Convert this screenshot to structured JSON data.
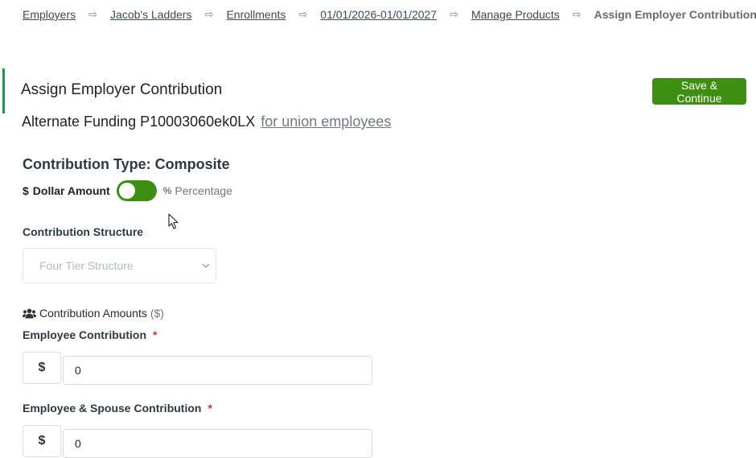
{
  "breadcrumb": {
    "items": [
      "Employers",
      "Jacob's Ladders",
      "Enrollments",
      "01/01/2026-01/01/2027",
      "Manage Products"
    ],
    "separator": "⇨",
    "current": "Assign Employer Contribution"
  },
  "panel": {
    "title": "Assign Employer Contribution",
    "save_label": "Save & Continue"
  },
  "funding": {
    "name": "Alternate Funding P10003060ek0LX",
    "link_text": "for union employees"
  },
  "contribution": {
    "type_heading": "Contribution Type: Composite",
    "dollar_glyph": "$",
    "dollar_label": "Dollar Amount",
    "percent_glyph": "%",
    "percent_label": "Percentage",
    "toggle_state": "dollar",
    "structure_label": "Contribution Structure",
    "structure_value": "Four Tier Structure",
    "amounts_label": "Contribution Amounts",
    "amounts_unit": "($)",
    "amounts_icon": "users-icon"
  },
  "fields": [
    {
      "label": "Employee Contribution",
      "required": "*",
      "addon": "$",
      "value": "0"
    },
    {
      "label": "Employee & Spouse Contribution",
      "required": "*",
      "addon": "$",
      "value": "0"
    }
  ],
  "colors": {
    "accent_green": "#3d8f14",
    "left_accent": "#1e9a4a",
    "required_red": "#d9302c"
  }
}
